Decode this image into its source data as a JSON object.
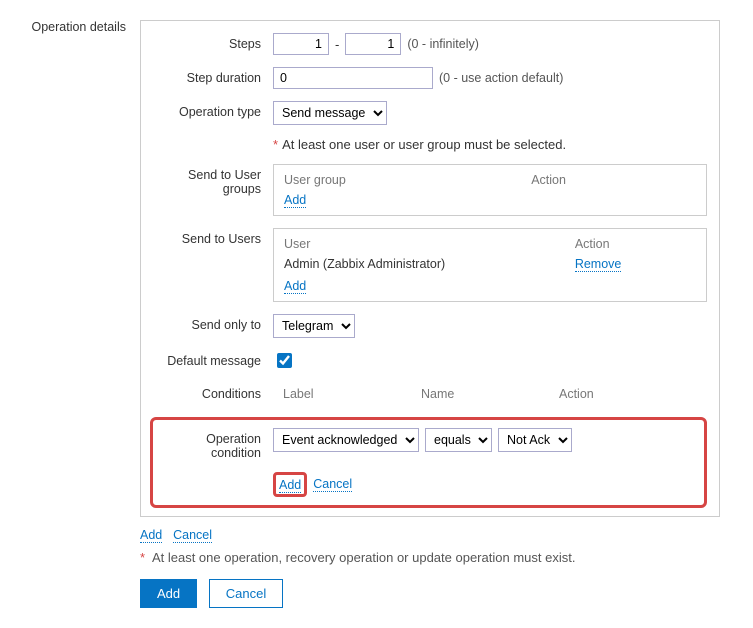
{
  "sectionLabel": "Operation details",
  "steps": {
    "label": "Steps",
    "from": "1",
    "to": "1",
    "hint": "(0 - infinitely)"
  },
  "stepDuration": {
    "label": "Step duration",
    "value": "0",
    "hint": "(0 - use action default)"
  },
  "operationType": {
    "label": "Operation type",
    "value": "Send message"
  },
  "validationMsg": "At least one user or user group must be selected.",
  "sendToUserGroups": {
    "label": "Send to User groups",
    "header1": "User group",
    "header2": "Action",
    "addLabel": "Add"
  },
  "sendToUsers": {
    "label": "Send to Users",
    "header1": "User",
    "header2": "Action",
    "user": "Admin (Zabbix Administrator)",
    "removeLabel": "Remove",
    "addLabel": "Add"
  },
  "sendOnlyTo": {
    "label": "Send only to",
    "value": "Telegram"
  },
  "defaultMessage": {
    "label": "Default message"
  },
  "conditions": {
    "label": "Conditions",
    "header1": "Label",
    "header2": "Name",
    "header3": "Action"
  },
  "operationCondition": {
    "label": "Operation condition",
    "field": "Event acknowledged",
    "op": "equals",
    "value": "Not Ack",
    "addLabel": "Add",
    "cancelLabel": "Cancel"
  },
  "outerAdd": "Add",
  "outerCancel": "Cancel",
  "footerNote": "At least one operation, recovery operation or update operation must exist.",
  "submitAdd": "Add",
  "submitCancel": "Cancel"
}
